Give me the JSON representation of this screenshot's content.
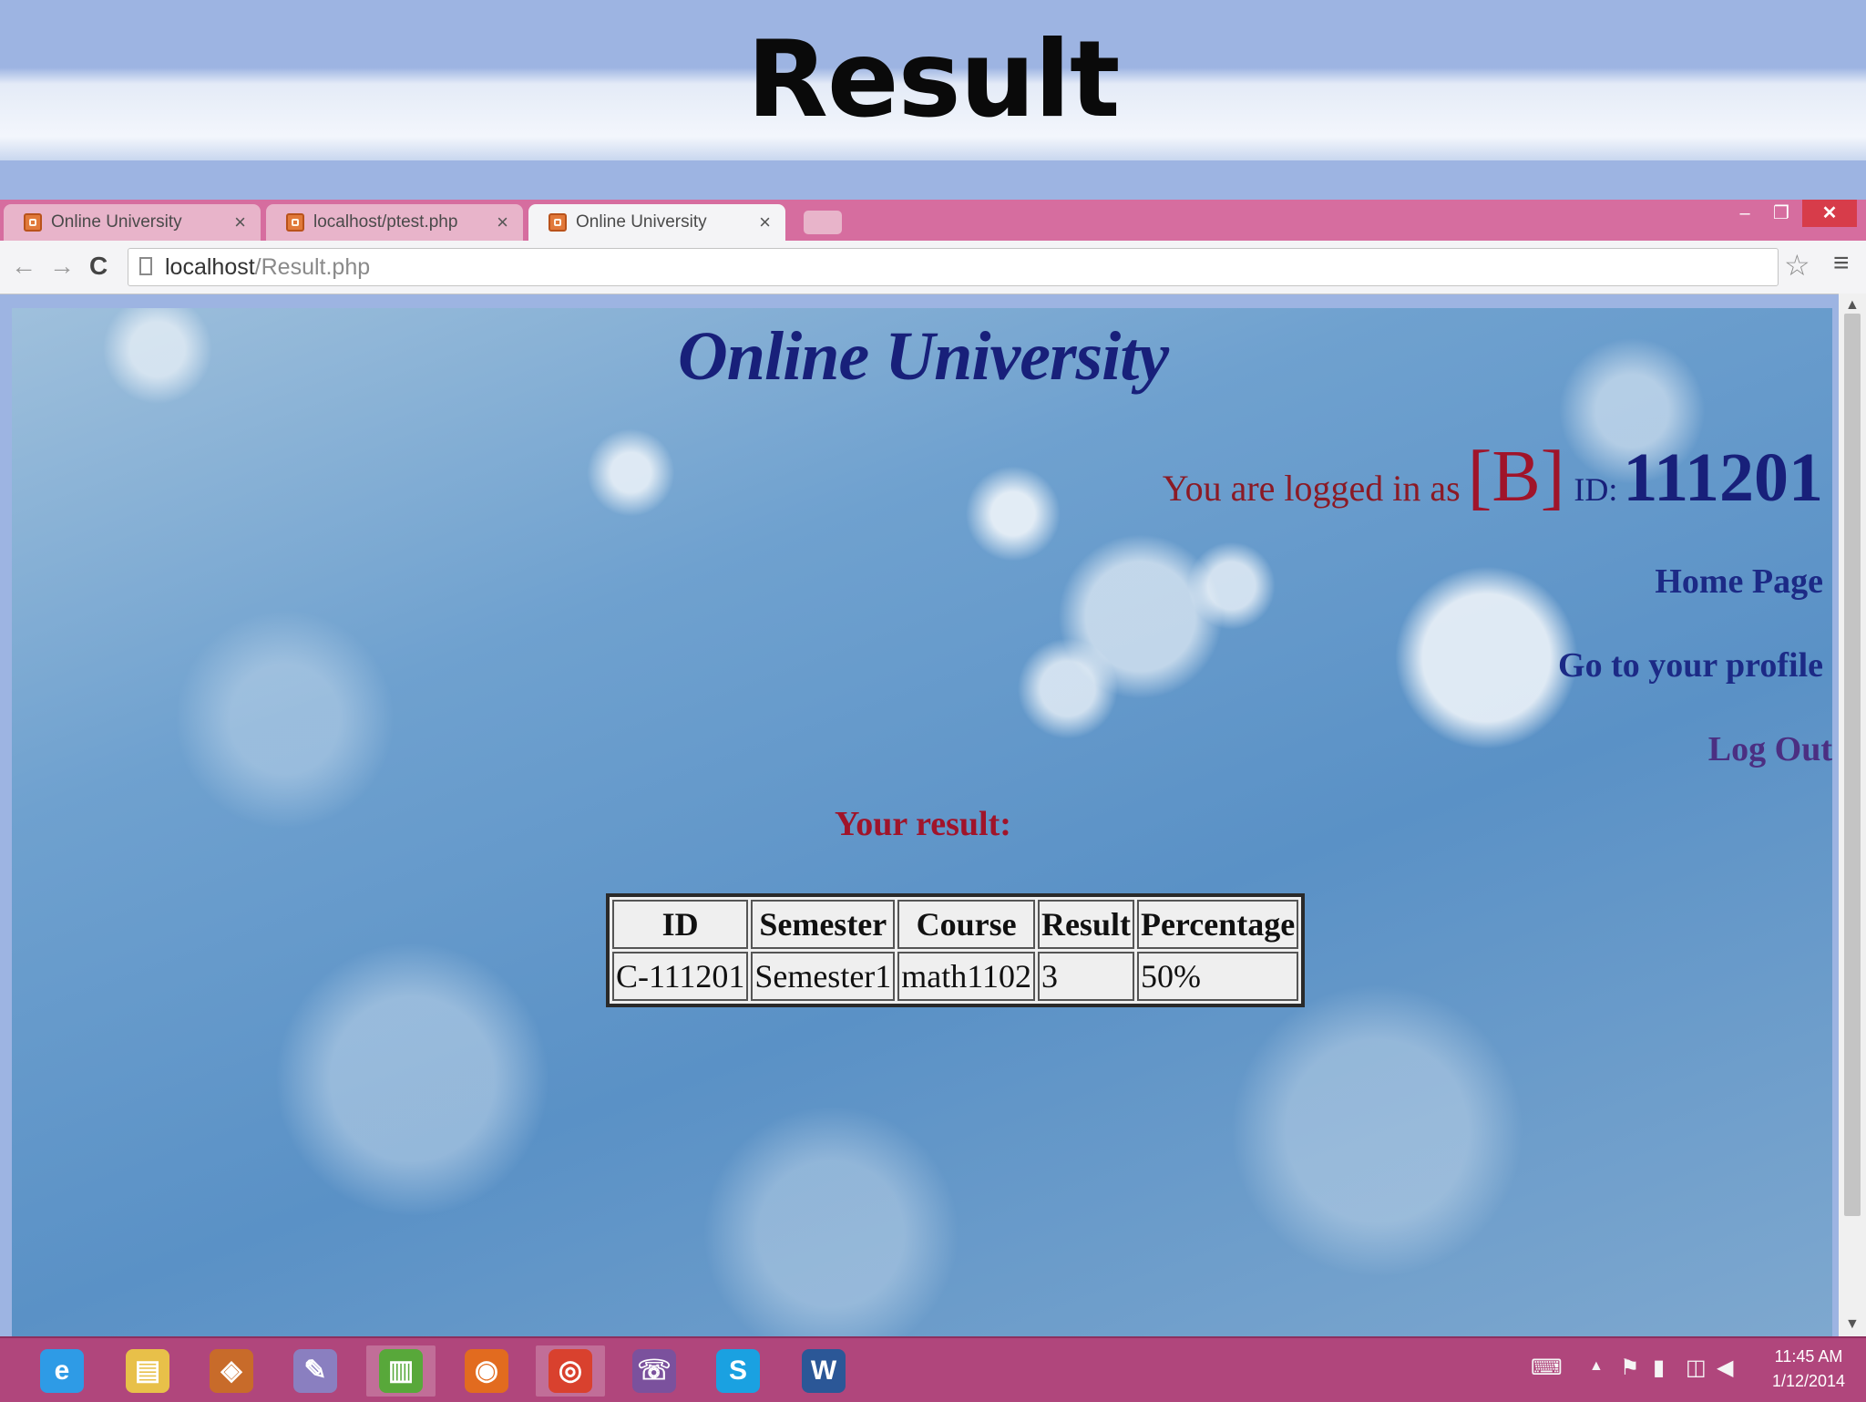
{
  "slide": {
    "title": "Result"
  },
  "browser": {
    "tabs": [
      {
        "label": "Online University",
        "active": false
      },
      {
        "label": "localhost/ptest.php",
        "active": false
      },
      {
        "label": "Online University",
        "active": true
      }
    ],
    "tab_close": "×",
    "url_host": "localhost",
    "url_path": "/Result.php",
    "window_controls": {
      "minimize": "–",
      "maximize": "❐",
      "close": "✕"
    },
    "nav": {
      "back": "←",
      "forward": "→",
      "reload": "C"
    },
    "star": "☆",
    "menu": "≡",
    "accent_tabstrip": "#d66d9f"
  },
  "page": {
    "site_title": "Online University",
    "login": {
      "prefix": "You are logged in as",
      "user": "[B]",
      "id_label": "ID:",
      "id": "111201"
    },
    "nav_links": {
      "home": "Home Page",
      "profile": "Go to your profile",
      "logout": "Log Out"
    },
    "result_heading": "Your result:",
    "table": {
      "headers": [
        "ID",
        "Semester",
        "Course",
        "Result",
        "Percentage"
      ],
      "rows": [
        [
          "C-111201",
          "Semester1",
          "math1102",
          "3",
          "50%"
        ]
      ]
    }
  },
  "taskbar": {
    "apps": [
      {
        "name": "internet-explorer-icon",
        "glyph": "e",
        "color": "#2e9be6",
        "active": false
      },
      {
        "name": "file-explorer-icon",
        "glyph": "▤",
        "color": "#e8c049",
        "active": false
      },
      {
        "name": "store-icon",
        "glyph": "◈",
        "color": "#c86b2a",
        "active": false
      },
      {
        "name": "paint-icon",
        "glyph": "✎",
        "color": "#8a7fc0",
        "active": false
      },
      {
        "name": "notepad-icon",
        "glyph": "▥",
        "color": "#58a83a",
        "active": true
      },
      {
        "name": "firefox-icon",
        "glyph": "◉",
        "color": "#e26b1f",
        "active": false
      },
      {
        "name": "chrome-icon",
        "glyph": "◎",
        "color": "#d9412e",
        "active": true
      },
      {
        "name": "viber-icon",
        "glyph": "☏",
        "color": "#7b519d",
        "active": false
      },
      {
        "name": "skype-icon",
        "glyph": "S",
        "color": "#1aa1e1",
        "active": false
      },
      {
        "name": "word-icon",
        "glyph": "W",
        "color": "#2b5797",
        "active": false
      }
    ],
    "tray_arrow": "▲",
    "clock_time": "11:45 AM",
    "clock_date": "1/12/2014"
  }
}
